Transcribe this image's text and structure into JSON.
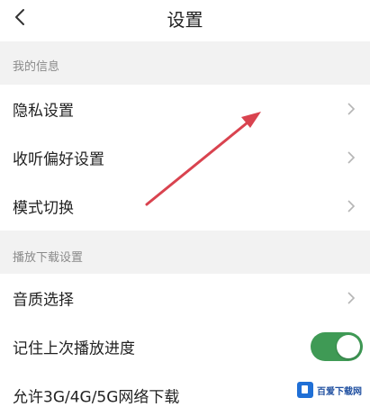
{
  "header": {
    "title": "设置"
  },
  "sections": [
    {
      "label": "我的信息",
      "items": [
        {
          "label": "隐私设置"
        },
        {
          "label": "收听偏好设置"
        },
        {
          "label": "模式切换"
        }
      ]
    },
    {
      "label": "播放下载设置",
      "items": [
        {
          "label": "音质选择"
        },
        {
          "label": "记住上次播放进度",
          "toggle": true
        },
        {
          "label": "允许3G/4G/5G网络下载"
        }
      ]
    }
  ],
  "colors": {
    "toggle_on": "#3f9a55",
    "annotation_arrow": "#d9434f"
  },
  "icons": [
    "back-arrow-icon",
    "chevron-right-icon"
  ],
  "watermark": {
    "text": "百爱下载网"
  }
}
